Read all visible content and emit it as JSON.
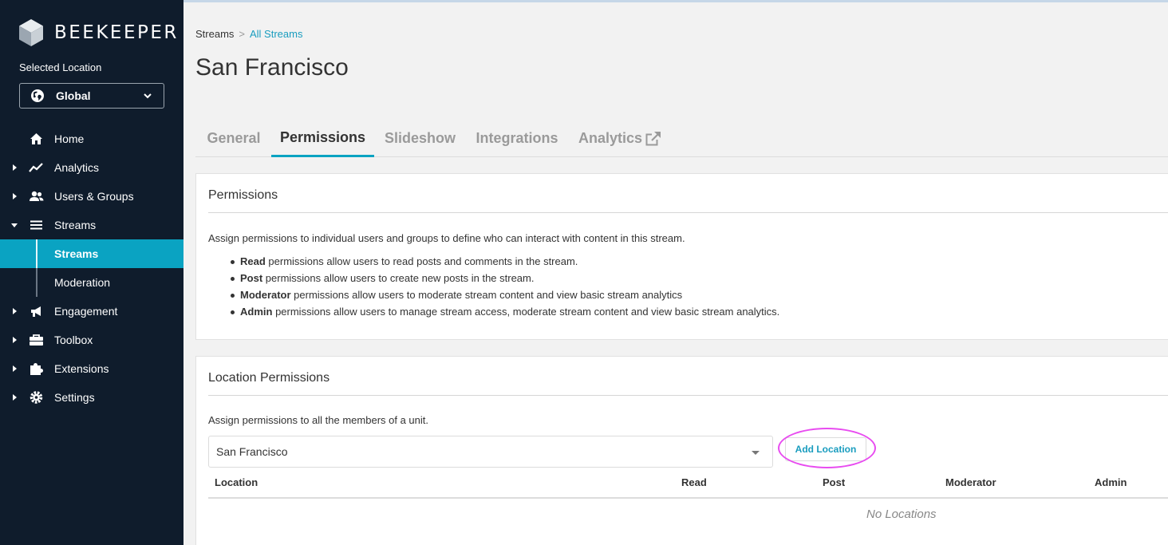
{
  "brand": {
    "name": "BEEKEEPER"
  },
  "location_selector": {
    "label": "Selected Location",
    "value": "Global"
  },
  "nav": {
    "items": [
      {
        "label": "Home",
        "icon": "home-icon"
      },
      {
        "label": "Analytics",
        "icon": "chart-line-icon"
      },
      {
        "label": "Users & Groups",
        "icon": "users-icon"
      },
      {
        "label": "Streams",
        "icon": "list-icon"
      },
      {
        "label": "Engagement",
        "icon": "megaphone-icon"
      },
      {
        "label": "Toolbox",
        "icon": "toolbox-icon"
      },
      {
        "label": "Extensions",
        "icon": "puzzle-icon"
      },
      {
        "label": "Settings",
        "icon": "gear-icon"
      }
    ],
    "sub_items": [
      {
        "label": "Streams",
        "active": true
      },
      {
        "label": "Moderation",
        "active": false
      }
    ]
  },
  "breadcrumb": {
    "root": "Streams",
    "separator": ">",
    "current": "All Streams"
  },
  "page": {
    "title": "San Francisco"
  },
  "tabs": [
    {
      "label": "General"
    },
    {
      "label": "Permissions",
      "active": true
    },
    {
      "label": "Slideshow"
    },
    {
      "label": "Integrations"
    },
    {
      "label": "Analytics",
      "icon": "external-link-icon"
    }
  ],
  "permissions_panel": {
    "title": "Permissions",
    "description": "Assign permissions to individual users and groups to define who can interact with content in this stream.",
    "items": [
      {
        "term": "Read",
        "text": " permissions allow users to read posts and comments in the stream."
      },
      {
        "term": "Post",
        "text": " permissions allow users to create new posts in the stream."
      },
      {
        "term": "Moderator",
        "text": " permissions allow users to moderate stream content and view basic stream analytics"
      },
      {
        "term": "Admin",
        "text": " permissions allow users to manage stream access, moderate stream content and view basic stream analytics."
      }
    ]
  },
  "location_panel": {
    "title": "Location Permissions",
    "description": "Assign permissions to all the members of a unit.",
    "selected_location": "San Francisco",
    "add_button": "Add Location",
    "columns": [
      "Location",
      "Read",
      "Post",
      "Moderator",
      "Admin"
    ],
    "empty_text": "No Locations"
  },
  "colors": {
    "sidebar": "#0f1c2c",
    "accent": "#0aa3c2",
    "link": "#1a9dbf",
    "highlight": "#e84cf0"
  }
}
